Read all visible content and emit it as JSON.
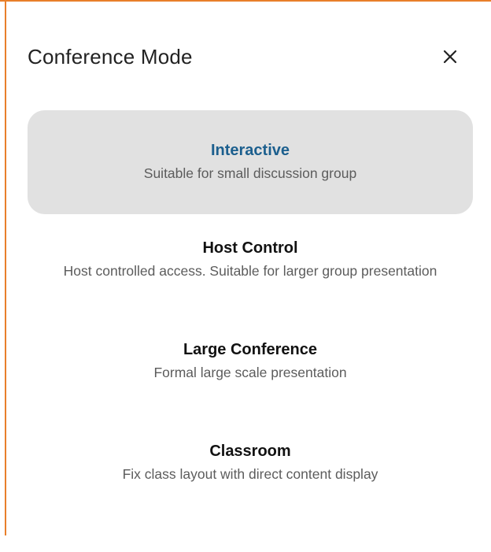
{
  "dialog": {
    "title": "Conference Mode",
    "close_icon": "close-icon",
    "accent_color": "#1c5f8e",
    "border_color": "#e87f2a",
    "selected_background": "#e1e1e1"
  },
  "modes": [
    {
      "name": "Interactive",
      "description": "Suitable for small discussion group",
      "selected": true
    },
    {
      "name": "Host Control",
      "description": "Host controlled access. Suitable for larger group presentation",
      "selected": false
    },
    {
      "name": "Large Conference",
      "description": "Formal large scale presentation",
      "selected": false
    },
    {
      "name": "Classroom",
      "description": "Fix class layout with direct content display",
      "selected": false
    }
  ]
}
